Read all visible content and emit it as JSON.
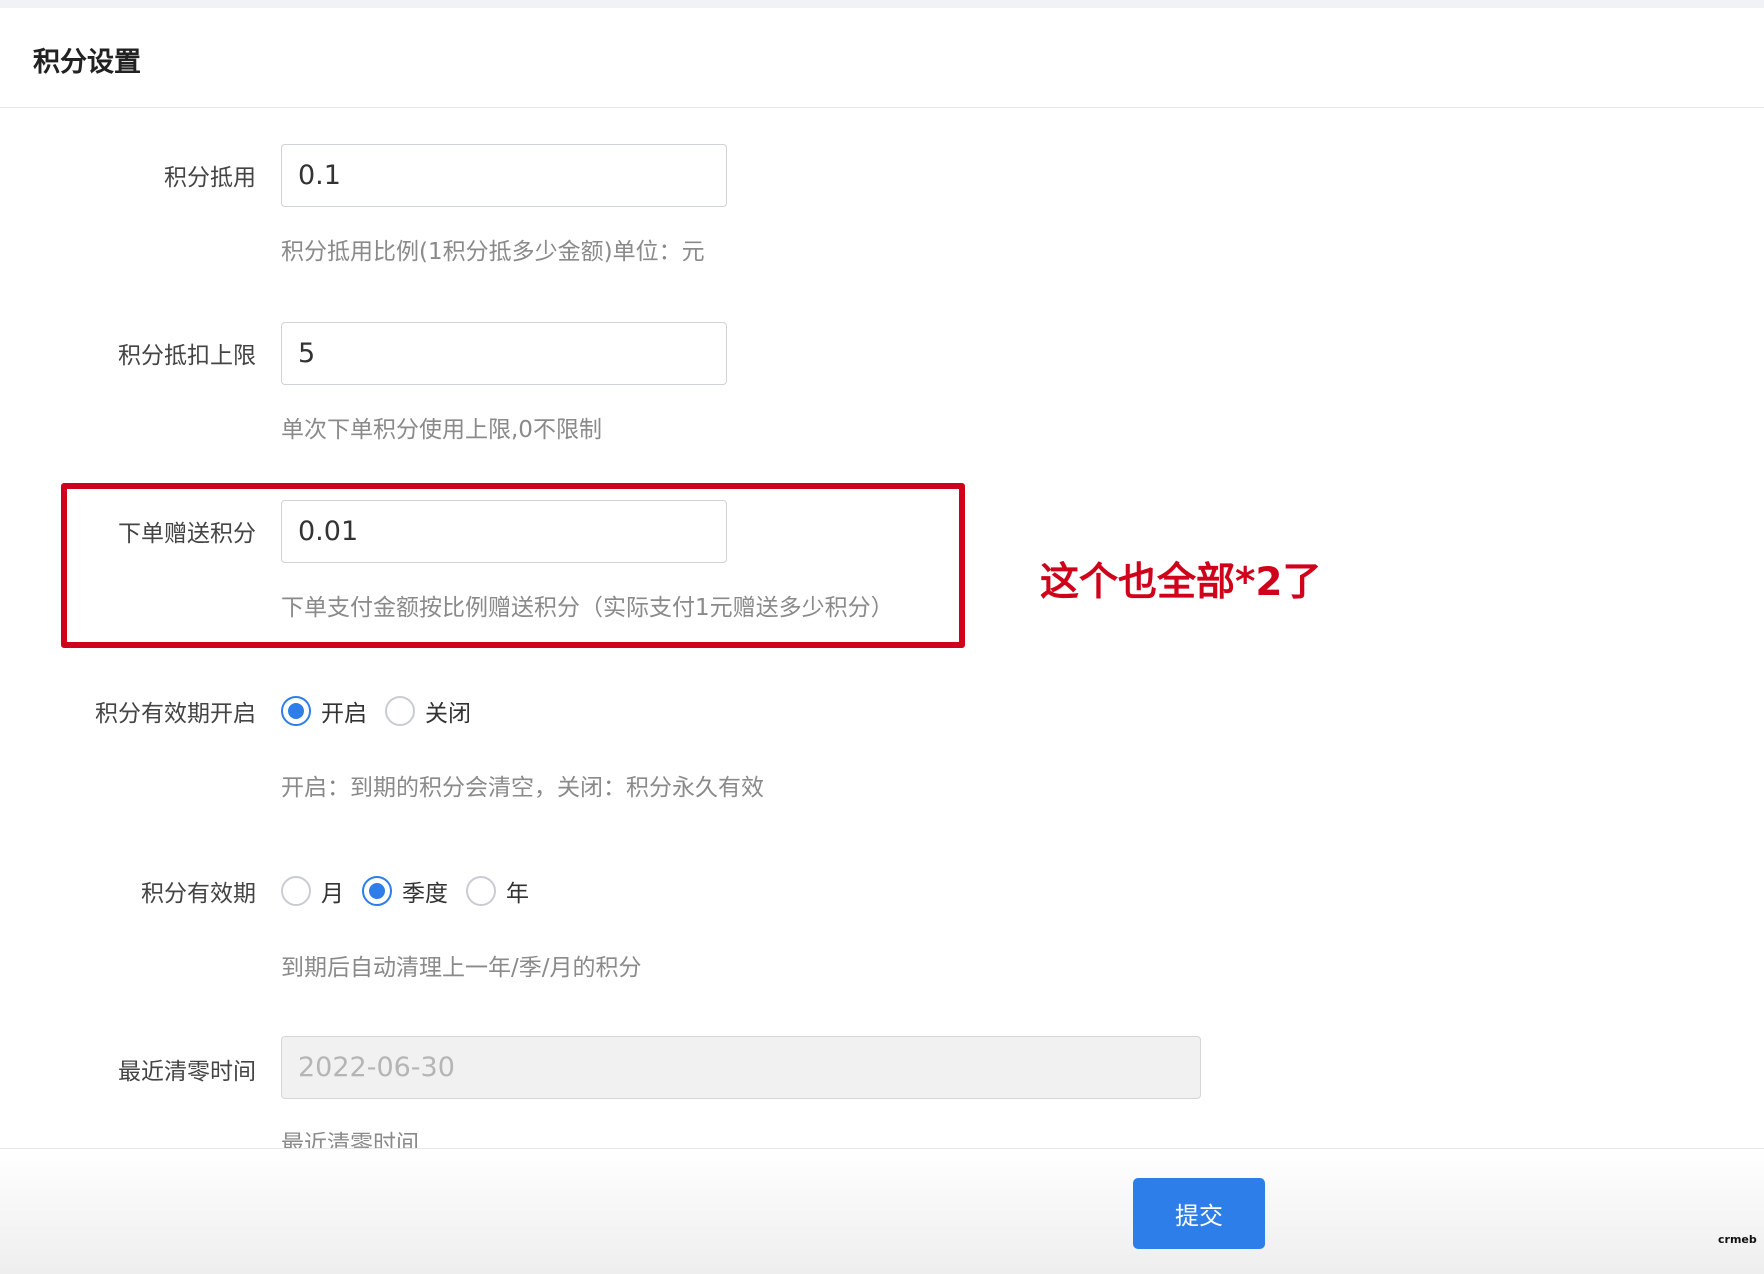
{
  "header": {
    "title": "积分设置"
  },
  "form": {
    "deduction": {
      "label": "积分抵用",
      "value": "0.1",
      "help": "积分抵用比例(1积分抵多少金额)单位：元"
    },
    "deduction_limit": {
      "label": "积分抵扣上限",
      "value": "5",
      "help": "单次下单积分使用上限,0不限制"
    },
    "order_gift": {
      "label": "下单赠送积分",
      "value": "0.01",
      "help": "下单支付金额按比例赠送积分（实际支付1元赠送多少积分）"
    },
    "validity_enable": {
      "label": "积分有效期开启",
      "options": [
        "开启",
        "关闭"
      ],
      "selected": "开启",
      "help": "开启：到期的积分会清空，关闭：积分永久有效"
    },
    "validity_period": {
      "label": "积分有效期",
      "options": [
        "月",
        "季度",
        "年"
      ],
      "selected": "季度",
      "help": "到期后自动清理上一年/季/月的积分"
    },
    "last_clear": {
      "label": "最近清零时间",
      "value": "2022-06-30",
      "help": "最近清零时间"
    }
  },
  "annotation": {
    "text": "这个也全部*2了",
    "color": "#d0021b"
  },
  "footer": {
    "submit_label": "提交"
  },
  "brand": {
    "logo_text": "crmeb"
  },
  "colors": {
    "primary": "#2d7ee8",
    "annotation_red": "#d0021b"
  }
}
